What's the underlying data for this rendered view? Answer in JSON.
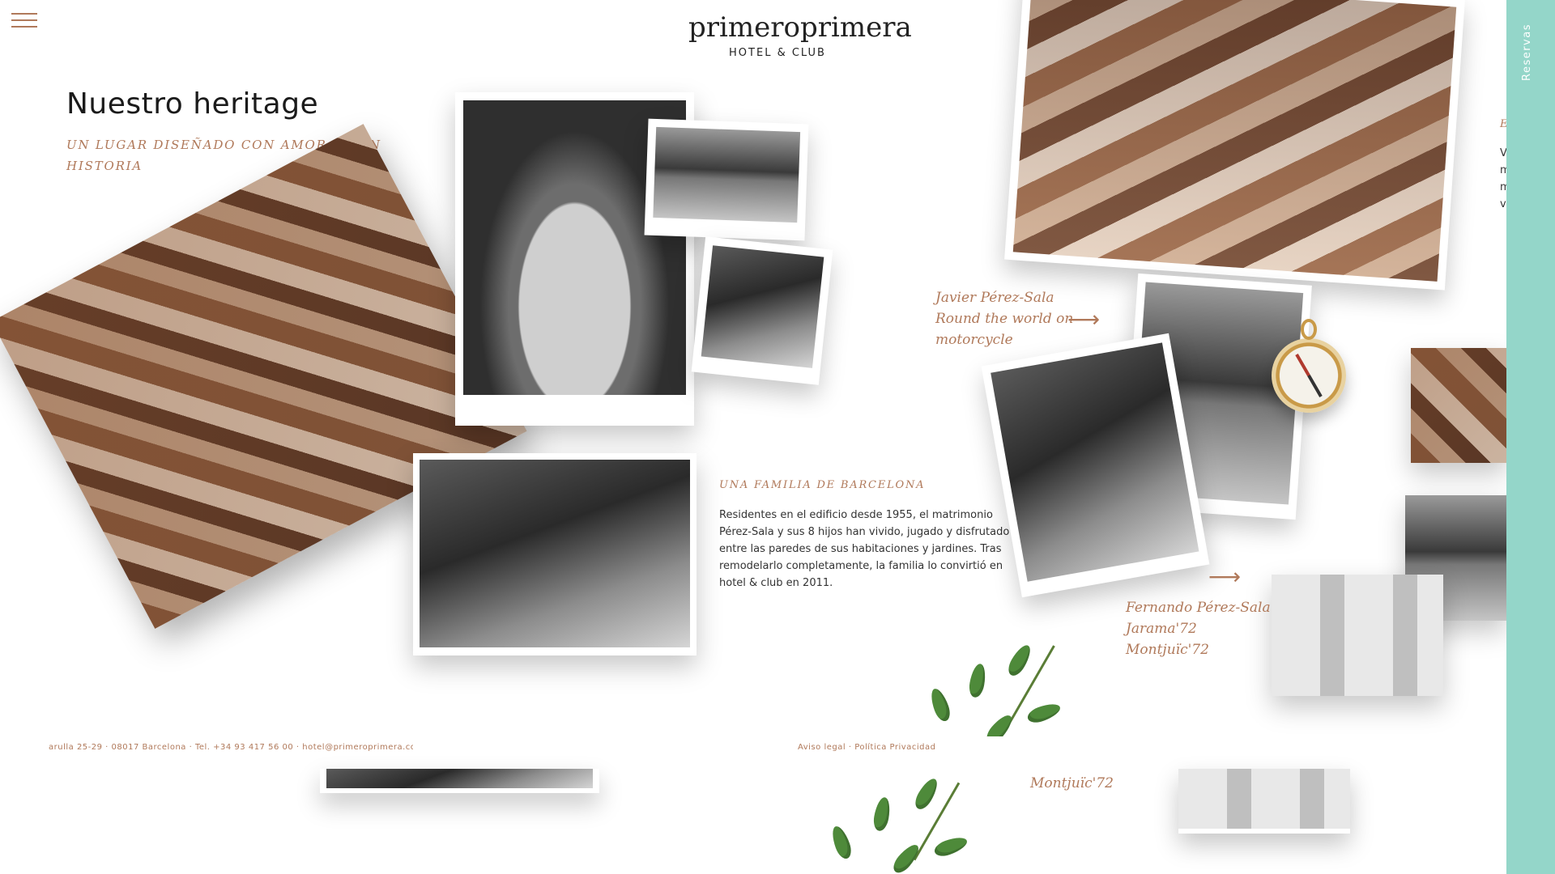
{
  "header": {
    "logo_main": "primeroprimera",
    "logo_sub": "HOTEL & CLUB"
  },
  "hero": {
    "title": "Nuestro heritage",
    "subtitle": "UN LUGAR DISEÑADO CON AMOR Y CON HISTORIA"
  },
  "family": {
    "heading": "UNA FAMILIA DE BARCELONA",
    "text": "Residentes en el edificio desde 1955, el matrimonio Pérez-Sala y sus 8 hijos han vivido, jugado y disfrutado entre las paredes de sus habitaciones y jardines. Tras remodelarlo completamente, la familia lo convirtió en hotel & club en 2011."
  },
  "captions": {
    "javier": "Javier Pérez-Sala\nRound the world on\nmotorcycle",
    "fernando": "Fernando Pérez-Sala\nJarama'72\nMontjuïc'72",
    "montjuic_lower": "Montjuïc'72"
  },
  "footer": {
    "address": "arulla 25-29 · 08017 Barcelona · Tel. +34 93 417 56 00 · hotel@primeroprimera.com",
    "legal": "Aviso legal",
    "separator": " · ",
    "privacy": "Política Privacidad"
  },
  "reservas": {
    "label": "Reservas"
  },
  "edge": {
    "heading": "E",
    "lines": [
      "V",
      "m",
      "m",
      "v"
    ]
  },
  "colors": {
    "accent": "#b0795a",
    "reservas_bg": "#94d6c9",
    "text": "#222222"
  }
}
